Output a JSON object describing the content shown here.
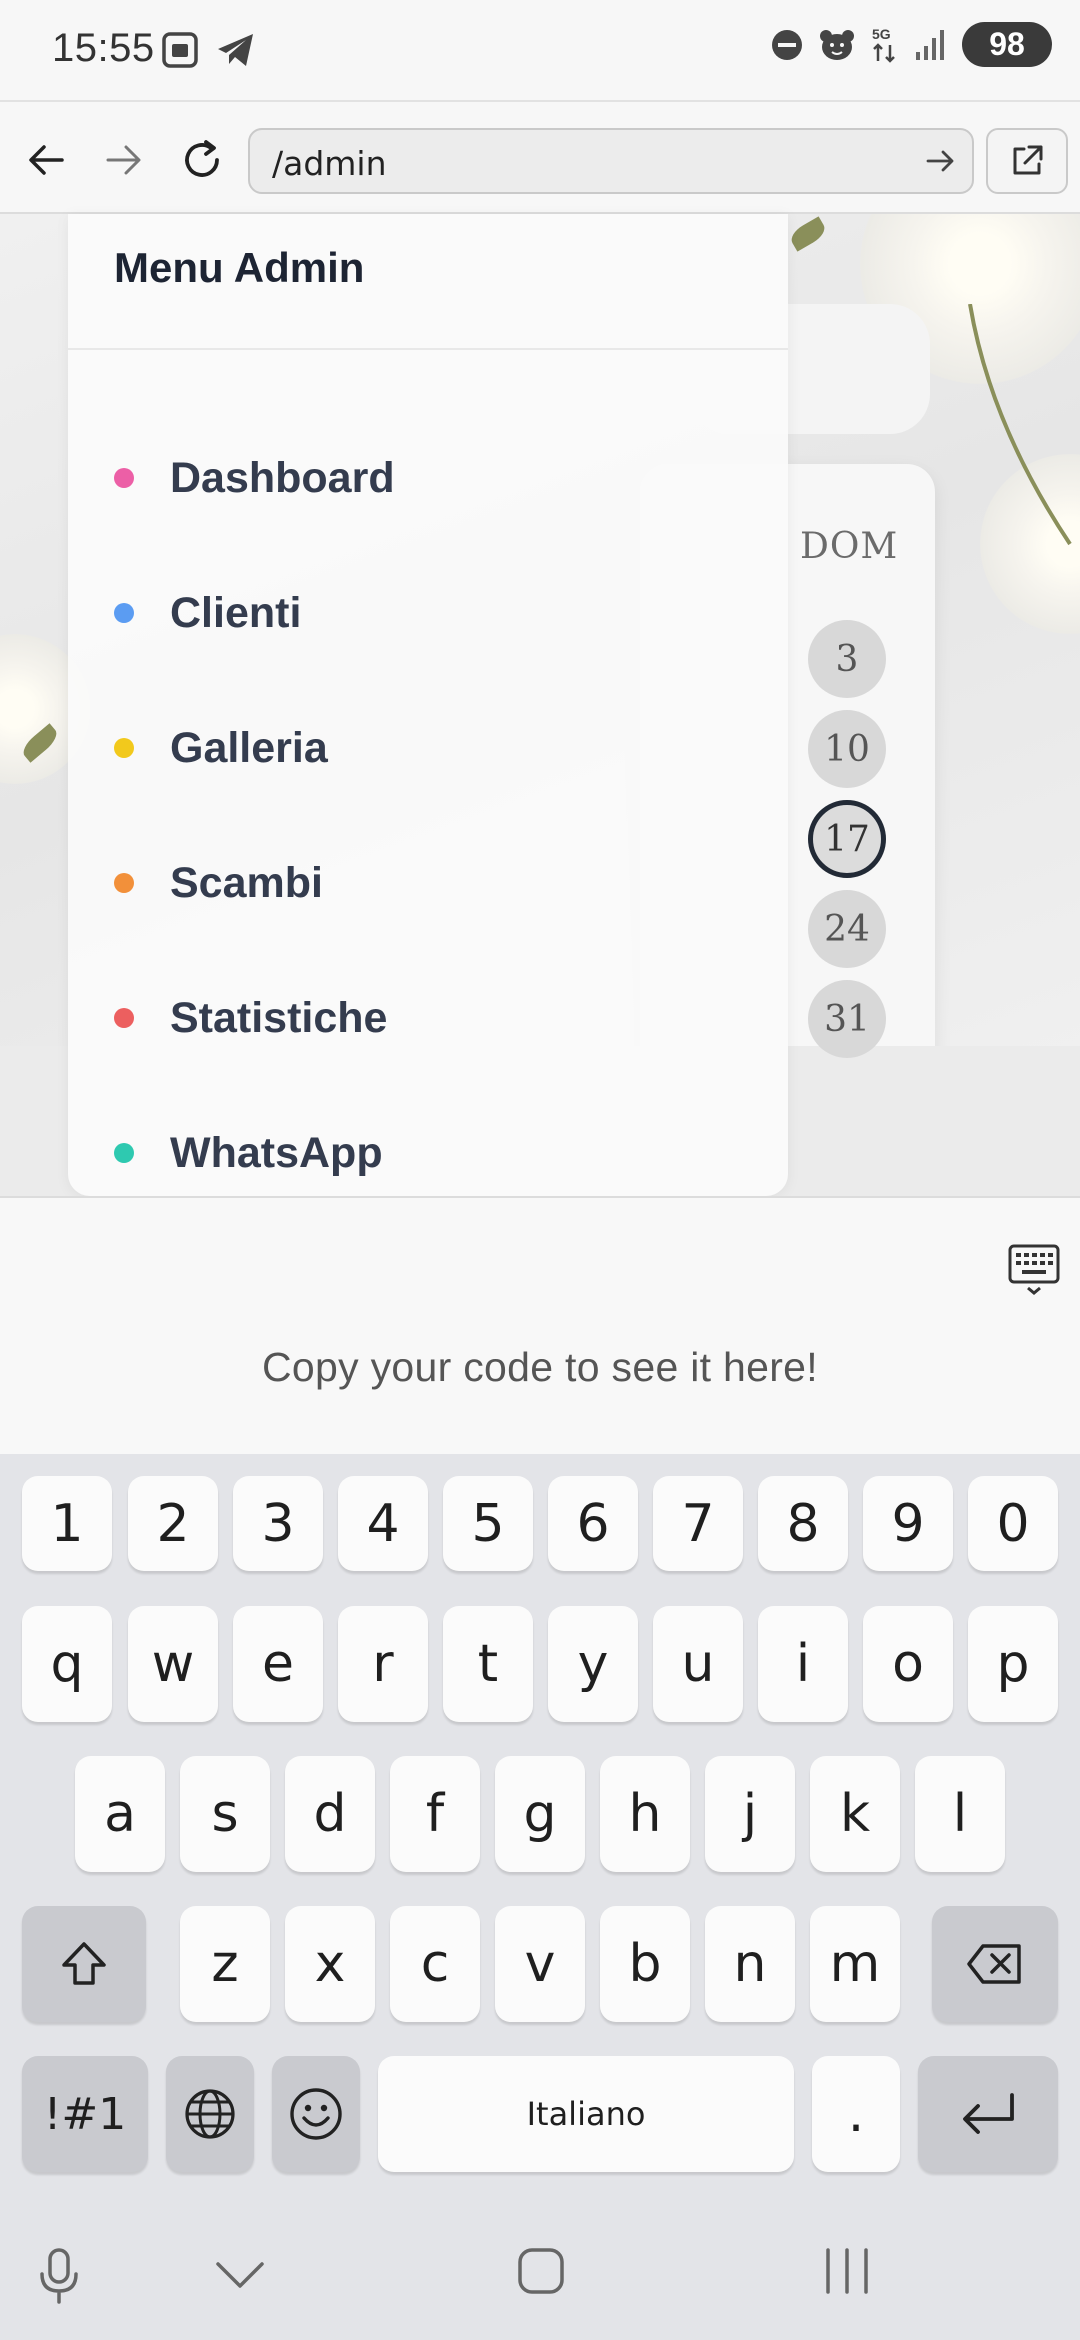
{
  "status_bar": {
    "time": "15:55",
    "battery": "98",
    "left_icons": [
      "screenshot-icon",
      "telegram-icon"
    ],
    "right_icons": [
      "dnd-icon",
      "bear-icon",
      "5g-data-icon",
      "signal-icon"
    ]
  },
  "browser": {
    "url": "/admin",
    "icons": [
      "back-arrow-icon",
      "forward-arrow-icon",
      "reload-icon",
      "go-arrow-icon",
      "open-external-icon"
    ]
  },
  "calendar": {
    "day_of_week": "DOM",
    "days": [
      "3",
      "10",
      "17",
      "24",
      "31"
    ],
    "today": "17"
  },
  "drawer": {
    "title": "Menu Admin",
    "items": [
      {
        "label": "Dashboard",
        "color": "#ec5fa6"
      },
      {
        "label": "Clienti",
        "color": "#5b9cf2"
      },
      {
        "label": "Galleria",
        "color": "#f2c91c"
      },
      {
        "label": "Scambi",
        "color": "#f2903a"
      },
      {
        "label": "Statistiche",
        "color": "#ec5f5f"
      },
      {
        "label": "WhatsApp",
        "color": "#2ec9b0"
      }
    ]
  },
  "preview": {
    "message": "Copy your code to see it here!"
  },
  "keyboard": {
    "row_numbers": [
      "1",
      "2",
      "3",
      "4",
      "5",
      "6",
      "7",
      "8",
      "9",
      "0"
    ],
    "row_top": [
      "q",
      "w",
      "e",
      "r",
      "t",
      "y",
      "u",
      "i",
      "o",
      "p"
    ],
    "row_middle": [
      "a",
      "s",
      "d",
      "f",
      "g",
      "h",
      "j",
      "k",
      "l"
    ],
    "row_bottom": [
      "z",
      "x",
      "c",
      "v",
      "b",
      "n",
      "m"
    ],
    "symbols_label": "!#1",
    "space_label": "Italiano",
    "period_label": ".",
    "icons": [
      "shift-icon",
      "backspace-icon",
      "globe-icon",
      "emoji-icon",
      "enter-icon",
      "keyboard-toggle-icon"
    ]
  },
  "navbar": {
    "icons": [
      "microphone-icon",
      "hide-keyboard-icon",
      "home-icon",
      "recents-icon"
    ]
  }
}
